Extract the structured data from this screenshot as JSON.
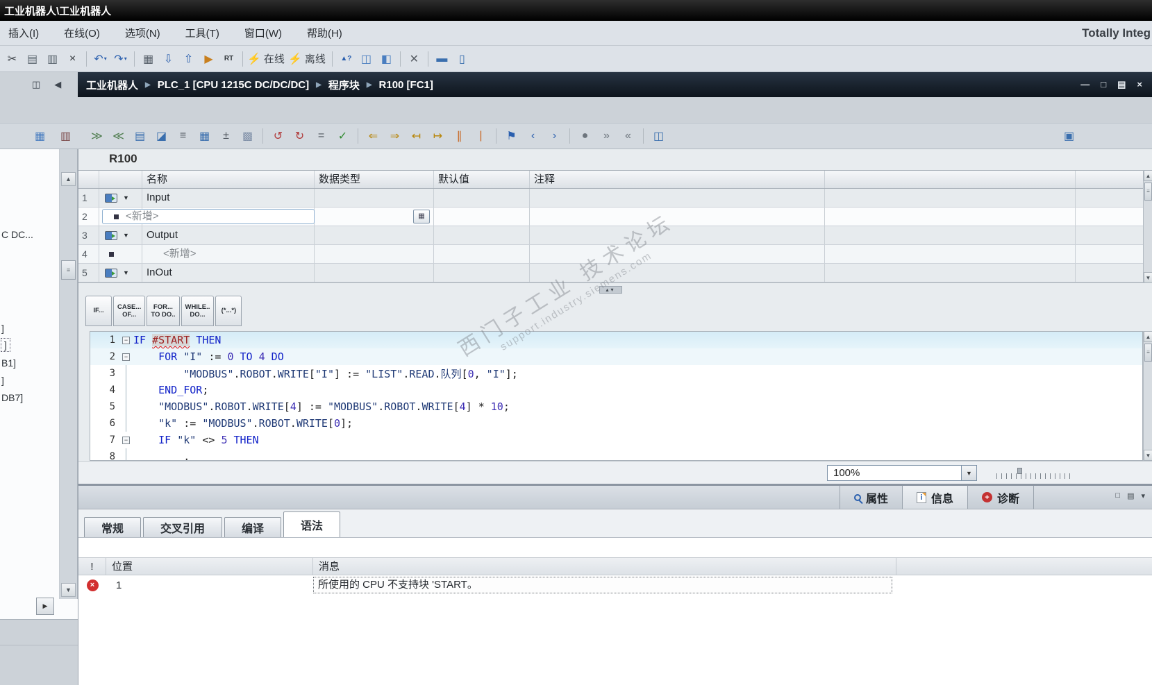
{
  "window": {
    "title": "工业机器人\\工业机器人",
    "brand": "Totally Integ"
  },
  "menu": {
    "items": [
      "插入(I)",
      "在线(O)",
      "选项(N)",
      "工具(T)",
      "窗口(W)",
      "帮助(H)"
    ]
  },
  "main_toolbar": {
    "icons": [
      {
        "name": "cut-icon",
        "glyph": "✂",
        "color": "#3d4248"
      },
      {
        "name": "copy-icon",
        "glyph": "▤",
        "color": "#5c6770"
      },
      {
        "name": "paste-icon",
        "glyph": "▥",
        "color": "#5c6770"
      },
      {
        "name": "delete-icon",
        "glyph": "×",
        "color": "#30353a"
      },
      {
        "sep": true
      },
      {
        "name": "undo-icon",
        "glyph": "↶",
        "color": "#2a5fae",
        "caret": true
      },
      {
        "name": "redo-icon",
        "glyph": "↷",
        "color": "#2a5fae",
        "caret": true
      },
      {
        "sep": true
      },
      {
        "name": "compile-icon",
        "glyph": "▦",
        "color": "#57606a"
      },
      {
        "name": "download-to-device-icon",
        "glyph": "⇩",
        "color": "#2a5fae"
      },
      {
        "name": "upload-from-device-icon",
        "glyph": "⇧",
        "color": "#2a5fae"
      },
      {
        "name": "start-cpu-icon",
        "glyph": "▶",
        "color": "#c87f1e"
      },
      {
        "name": "start-runtime-icon",
        "glyph": "RT",
        "color": "#30353a",
        "small": true
      },
      {
        "sep": true
      },
      {
        "name": "go-online-button",
        "glyph": "⚡",
        "color": "#c8940a",
        "label": "在线"
      },
      {
        "name": "go-offline-button",
        "glyph": "⚡",
        "color": "#6d757d",
        "label": "离线"
      },
      {
        "sep": true
      },
      {
        "name": "accessible-devices-icon",
        "glyph": "▲?",
        "color": "#2a5fae",
        "small": true
      },
      {
        "name": "start-simulation-icon",
        "glyph": "◫",
        "color": "#4a7ec0"
      },
      {
        "name": "simulation-panel-icon",
        "glyph": "◧",
        "color": "#4a7ec0"
      },
      {
        "sep": true
      },
      {
        "name": "cross-reference-icon",
        "glyph": "✕",
        "color": "#555b62"
      },
      {
        "sep": true
      },
      {
        "name": "split-editor-horizontal-icon",
        "glyph": "▬",
        "color": "#3a6fae"
      },
      {
        "name": "split-editor-vertical-icon",
        "glyph": "▯",
        "color": "#3a6fae"
      }
    ]
  },
  "breadcrumb": {
    "separator": "▶",
    "items": [
      "工业机器人",
      "PLC_1 [CPU 1215C DC/DC/DC]",
      "程序块",
      "R100 [FC1]"
    ],
    "window_buttons": [
      {
        "name": "minimize-button",
        "glyph": "—"
      },
      {
        "name": "restore-button",
        "glyph": "□"
      },
      {
        "name": "dock-button",
        "glyph": "▤"
      },
      {
        "name": "close-button",
        "glyph": "×"
      }
    ]
  },
  "editor_toolbar": {
    "left_icons": [
      {
        "name": "overview-window-icon",
        "glyph": "▦",
        "color": "#4a7ec0"
      },
      {
        "name": "task-card-icon",
        "glyph": "▥",
        "color": "#7c4a4a"
      }
    ],
    "icons": [
      {
        "name": "insert-line-icon",
        "glyph": "≫",
        "color": "#4f7d4f"
      },
      {
        "name": "append-line-icon",
        "glyph": "≪",
        "color": "#4f7d4f"
      },
      {
        "name": "open-block-icon",
        "glyph": "▤",
        "color": "#3a6fae"
      },
      {
        "name": "call-structure-icon",
        "glyph": "◪",
        "color": "#3a6fae"
      },
      {
        "name": "network-comments-icon",
        "glyph": "≡",
        "color": "#4f565e"
      },
      {
        "name": "insert-network-icon",
        "glyph": "▦",
        "color": "#3a6fae"
      },
      {
        "name": "absolute-symbolic-toggle-icon",
        "glyph": "±",
        "color": "#4f565e"
      },
      {
        "name": "favorites-icon",
        "glyph": "▩",
        "color": "#8090a8"
      },
      {
        "sep": true
      },
      {
        "name": "reset-start-values-icon",
        "glyph": "↺",
        "color": "#b03a3a"
      },
      {
        "name": "apply-start-values-icon",
        "glyph": "↻",
        "color": "#b03a3a"
      },
      {
        "name": "compare-icon",
        "glyph": "=",
        "color": "#4f565e"
      },
      {
        "name": "compile-block-icon",
        "glyph": "✓",
        "color": "#2f8a2f"
      },
      {
        "sep": true
      },
      {
        "name": "previous-position-icon",
        "glyph": "⇐",
        "color": "#b8860b"
      },
      {
        "name": "next-position-icon",
        "glyph": "⇒",
        "color": "#b8860b"
      },
      {
        "name": "outdent-icon",
        "glyph": "↤",
        "color": "#b8860b"
      },
      {
        "name": "indent-icon",
        "glyph": "↦",
        "color": "#b8860b"
      },
      {
        "name": "comment-lines-icon",
        "glyph": "∥",
        "color": "#c8641e"
      },
      {
        "name": "uncomment-lines-icon",
        "glyph": "|",
        "color": "#c8641e"
      },
      {
        "sep": true
      },
      {
        "name": "set-bookmark-icon",
        "glyph": "⚑",
        "color": "#2a5fae"
      },
      {
        "name": "previous-bookmark-icon",
        "glyph": "‹",
        "color": "#2a5fae"
      },
      {
        "name": "next-bookmark-icon",
        "glyph": "›",
        "color": "#2a5fae"
      },
      {
        "sep": true
      },
      {
        "name": "user-administration-icon",
        "glyph": "●",
        "color": "#6d757d"
      },
      {
        "name": "expand-all-icon",
        "glyph": "»",
        "color": "#6d757d"
      },
      {
        "name": "collapse-all-icon",
        "glyph": "«",
        "color": "#6d757d"
      },
      {
        "sep": true
      },
      {
        "name": "structured-view-icon",
        "glyph": "◫",
        "color": "#3a6fae"
      }
    ],
    "right_icons": [
      {
        "name": "open-in-editor-icon",
        "glyph": "▣",
        "color": "#3a6fae"
      }
    ]
  },
  "block": {
    "name": "R100"
  },
  "interface_table": {
    "headers": [
      "名称",
      "数据类型",
      "默认值",
      "注释"
    ],
    "rows": [
      {
        "num": "1",
        "kind": "section",
        "name": "Input"
      },
      {
        "num": "2",
        "kind": "new",
        "name": "<新增>",
        "selected": true,
        "type_button": true
      },
      {
        "num": "3",
        "kind": "section",
        "name": "Output"
      },
      {
        "num": "4",
        "kind": "new",
        "name": "<新增>"
      },
      {
        "num": "5",
        "kind": "section",
        "name": "InOut"
      }
    ]
  },
  "snippets": [
    {
      "name": "snippet-if",
      "line1": "IF...",
      "line2": ""
    },
    {
      "name": "snippet-case",
      "line1": "CASE...",
      "line2": "OF..."
    },
    {
      "name": "snippet-for",
      "line1": "FOR...",
      "line2": "TO DO.."
    },
    {
      "name": "snippet-while",
      "line1": "WHILE..",
      "line2": "DO..."
    },
    {
      "name": "snippet-comment",
      "line1": "(*...*)",
      "line2": ""
    }
  ],
  "code": {
    "lines": [
      {
        "n": "1",
        "fold": "minus",
        "hl": 1,
        "tokens": [
          {
            "c": "kw",
            "t": "IF "
          },
          {
            "c": "err",
            "t": "#START"
          },
          {
            "c": "kw",
            "t": " THEN"
          }
        ]
      },
      {
        "n": "2",
        "fold": "minus",
        "hl": 2,
        "tokens": [
          {
            "c": "pl",
            "t": "    "
          },
          {
            "c": "kw",
            "t": "FOR "
          },
          {
            "c": "id",
            "t": "\"I\""
          },
          {
            "c": "op",
            "t": " := "
          },
          {
            "c": "num",
            "t": "0"
          },
          {
            "c": "kw",
            "t": " TO "
          },
          {
            "c": "num",
            "t": "4"
          },
          {
            "c": "kw",
            "t": " DO"
          }
        ]
      },
      {
        "n": "3",
        "fold": "line",
        "tokens": [
          {
            "c": "pl",
            "t": "        "
          },
          {
            "c": "id",
            "t": "\"MODBUS\""
          },
          {
            "c": "op",
            "t": "."
          },
          {
            "c": "id",
            "t": "ROBOT"
          },
          {
            "c": "op",
            "t": "."
          },
          {
            "c": "id",
            "t": "WRITE"
          },
          {
            "c": "op",
            "t": "["
          },
          {
            "c": "id",
            "t": "\"I\""
          },
          {
            "c": "op",
            "t": "] := "
          },
          {
            "c": "id",
            "t": "\"LIST\""
          },
          {
            "c": "op",
            "t": "."
          },
          {
            "c": "id",
            "t": "READ"
          },
          {
            "c": "op",
            "t": "."
          },
          {
            "c": "id",
            "t": "队列"
          },
          {
            "c": "op",
            "t": "["
          },
          {
            "c": "num",
            "t": "0"
          },
          {
            "c": "op",
            "t": ", "
          },
          {
            "c": "id",
            "t": "\"I\""
          },
          {
            "c": "op",
            "t": "];"
          }
        ]
      },
      {
        "n": "4",
        "fold": "line",
        "tokens": [
          {
            "c": "pl",
            "t": "    "
          },
          {
            "c": "kw",
            "t": "END_FOR"
          },
          {
            "c": "op",
            "t": ";"
          }
        ]
      },
      {
        "n": "5",
        "fold": "line",
        "tokens": [
          {
            "c": "pl",
            "t": "    "
          },
          {
            "c": "id",
            "t": "\"MODBUS\""
          },
          {
            "c": "op",
            "t": "."
          },
          {
            "c": "id",
            "t": "ROBOT"
          },
          {
            "c": "op",
            "t": "."
          },
          {
            "c": "id",
            "t": "WRITE"
          },
          {
            "c": "op",
            "t": "["
          },
          {
            "c": "num",
            "t": "4"
          },
          {
            "c": "op",
            "t": "] := "
          },
          {
            "c": "id",
            "t": "\"MODBUS\""
          },
          {
            "c": "op",
            "t": "."
          },
          {
            "c": "id",
            "t": "ROBOT"
          },
          {
            "c": "op",
            "t": "."
          },
          {
            "c": "id",
            "t": "WRITE"
          },
          {
            "c": "op",
            "t": "["
          },
          {
            "c": "num",
            "t": "4"
          },
          {
            "c": "op",
            "t": "] "
          },
          {
            "c": "op",
            "t": "* "
          },
          {
            "c": "num",
            "t": "10"
          },
          {
            "c": "op",
            "t": ";"
          }
        ]
      },
      {
        "n": "6",
        "fold": "line",
        "tokens": [
          {
            "c": "pl",
            "t": "    "
          },
          {
            "c": "id",
            "t": "\"k\""
          },
          {
            "c": "op",
            "t": " := "
          },
          {
            "c": "id",
            "t": "\"MODBUS\""
          },
          {
            "c": "op",
            "t": "."
          },
          {
            "c": "id",
            "t": "ROBOT"
          },
          {
            "c": "op",
            "t": "."
          },
          {
            "c": "id",
            "t": "WRITE"
          },
          {
            "c": "op",
            "t": "["
          },
          {
            "c": "num",
            "t": "0"
          },
          {
            "c": "op",
            "t": "];"
          }
        ]
      },
      {
        "n": "7",
        "fold": "minus",
        "tokens": [
          {
            "c": "pl",
            "t": "    "
          },
          {
            "c": "kw",
            "t": "IF "
          },
          {
            "c": "id",
            "t": "\"k\""
          },
          {
            "c": "op",
            "t": " <> "
          },
          {
            "c": "num",
            "t": "5"
          },
          {
            "c": "kw",
            "t": " THEN"
          }
        ]
      },
      {
        "n": "8",
        "fold": "line",
        "tokens": [
          {
            "c": "pl",
            "t": "        "
          },
          {
            "c": "op",
            "t": "."
          }
        ]
      }
    ]
  },
  "zoom": {
    "value": "100%"
  },
  "watermark": {
    "line1": "西门子工业 技术论坛",
    "line2": "support.industry.siemens.com"
  },
  "inspector": {
    "tabs": [
      {
        "label": "属性",
        "icon": "properties"
      },
      {
        "label": "信息",
        "icon": "info",
        "active": true
      },
      {
        "label": "诊断",
        "icon": "diagnostics"
      }
    ],
    "subtabs": [
      {
        "label": "常规"
      },
      {
        "label": "交叉引用"
      },
      {
        "label": "编译"
      },
      {
        "label": "语法",
        "active": true
      }
    ],
    "window_buttons": [
      {
        "name": "restore-panel-button",
        "glyph": "□"
      },
      {
        "name": "panel-list-button",
        "glyph": "▤"
      },
      {
        "name": "panel-menu-button",
        "glyph": "▾"
      }
    ]
  },
  "messages": {
    "headers": [
      "!",
      "位置",
      "消息"
    ],
    "rows": [
      {
        "level": "error",
        "position": "1",
        "message": "所使用的 CPU 不支持块 'START。"
      }
    ]
  },
  "left_panel": {
    "fragments": [
      {
        "text": "C DC..."
      },
      {
        "text": "]"
      },
      {
        "text": "]",
        "selected": true
      },
      {
        "text": "B1]"
      },
      {
        "text": "]"
      },
      {
        "text": "DB7]"
      }
    ]
  }
}
